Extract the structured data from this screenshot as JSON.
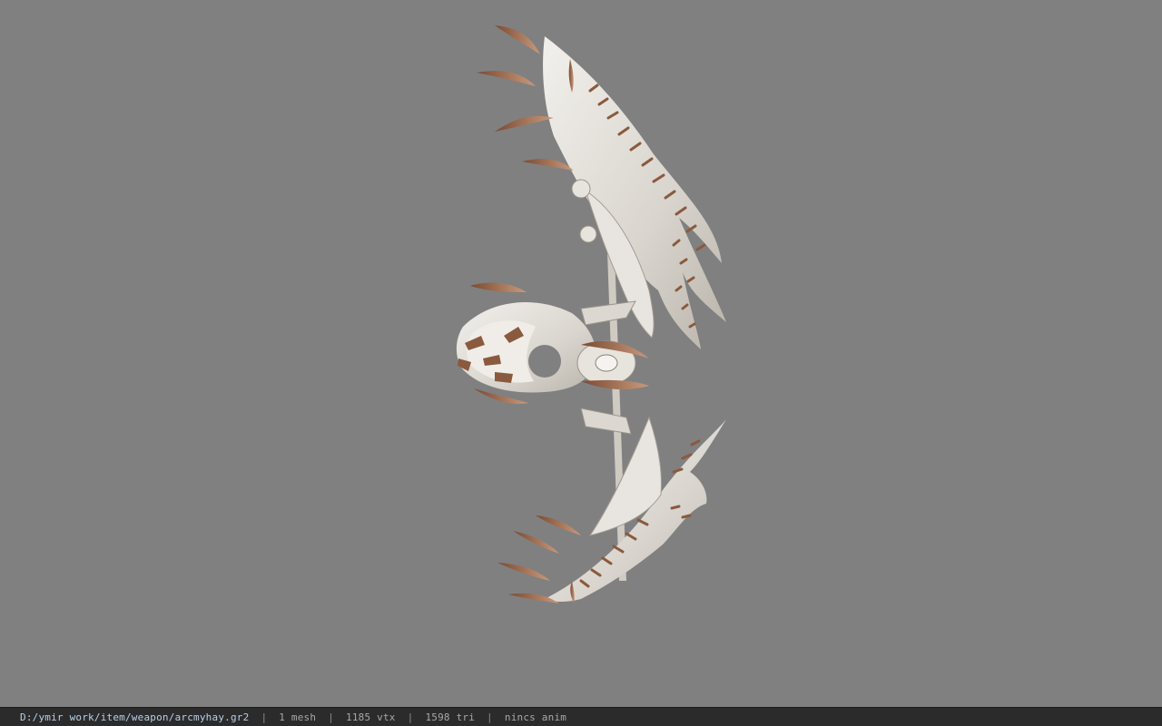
{
  "viewer": {
    "background_color": "#808080",
    "model_icon": "bow-weapon-model"
  },
  "status": {
    "file_path": "D:/ymir work/item/weapon/arcmyhay.gr2",
    "separator": "|",
    "mesh": "1 mesh",
    "vertices": "1185 vtx",
    "triangles": "1598 tri",
    "animation": "nincs anim"
  }
}
